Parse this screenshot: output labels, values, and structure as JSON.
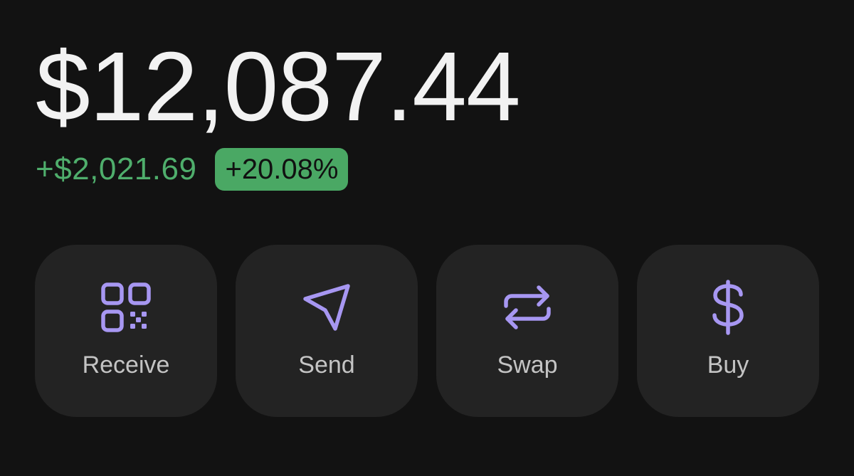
{
  "portfolio": {
    "balance": "$12,087.44",
    "change_amount": "+$2,021.69",
    "change_percent": "+20.08%"
  },
  "colors": {
    "positive": "#4fae6c",
    "accent_icon": "#a797f2",
    "card_bg": "#232323",
    "page_bg": "#121212"
  },
  "actions": [
    {
      "label": "Receive",
      "icon": "qr-code-icon"
    },
    {
      "label": "Send",
      "icon": "send-icon"
    },
    {
      "label": "Swap",
      "icon": "swap-icon"
    },
    {
      "label": "Buy",
      "icon": "dollar-icon"
    }
  ]
}
